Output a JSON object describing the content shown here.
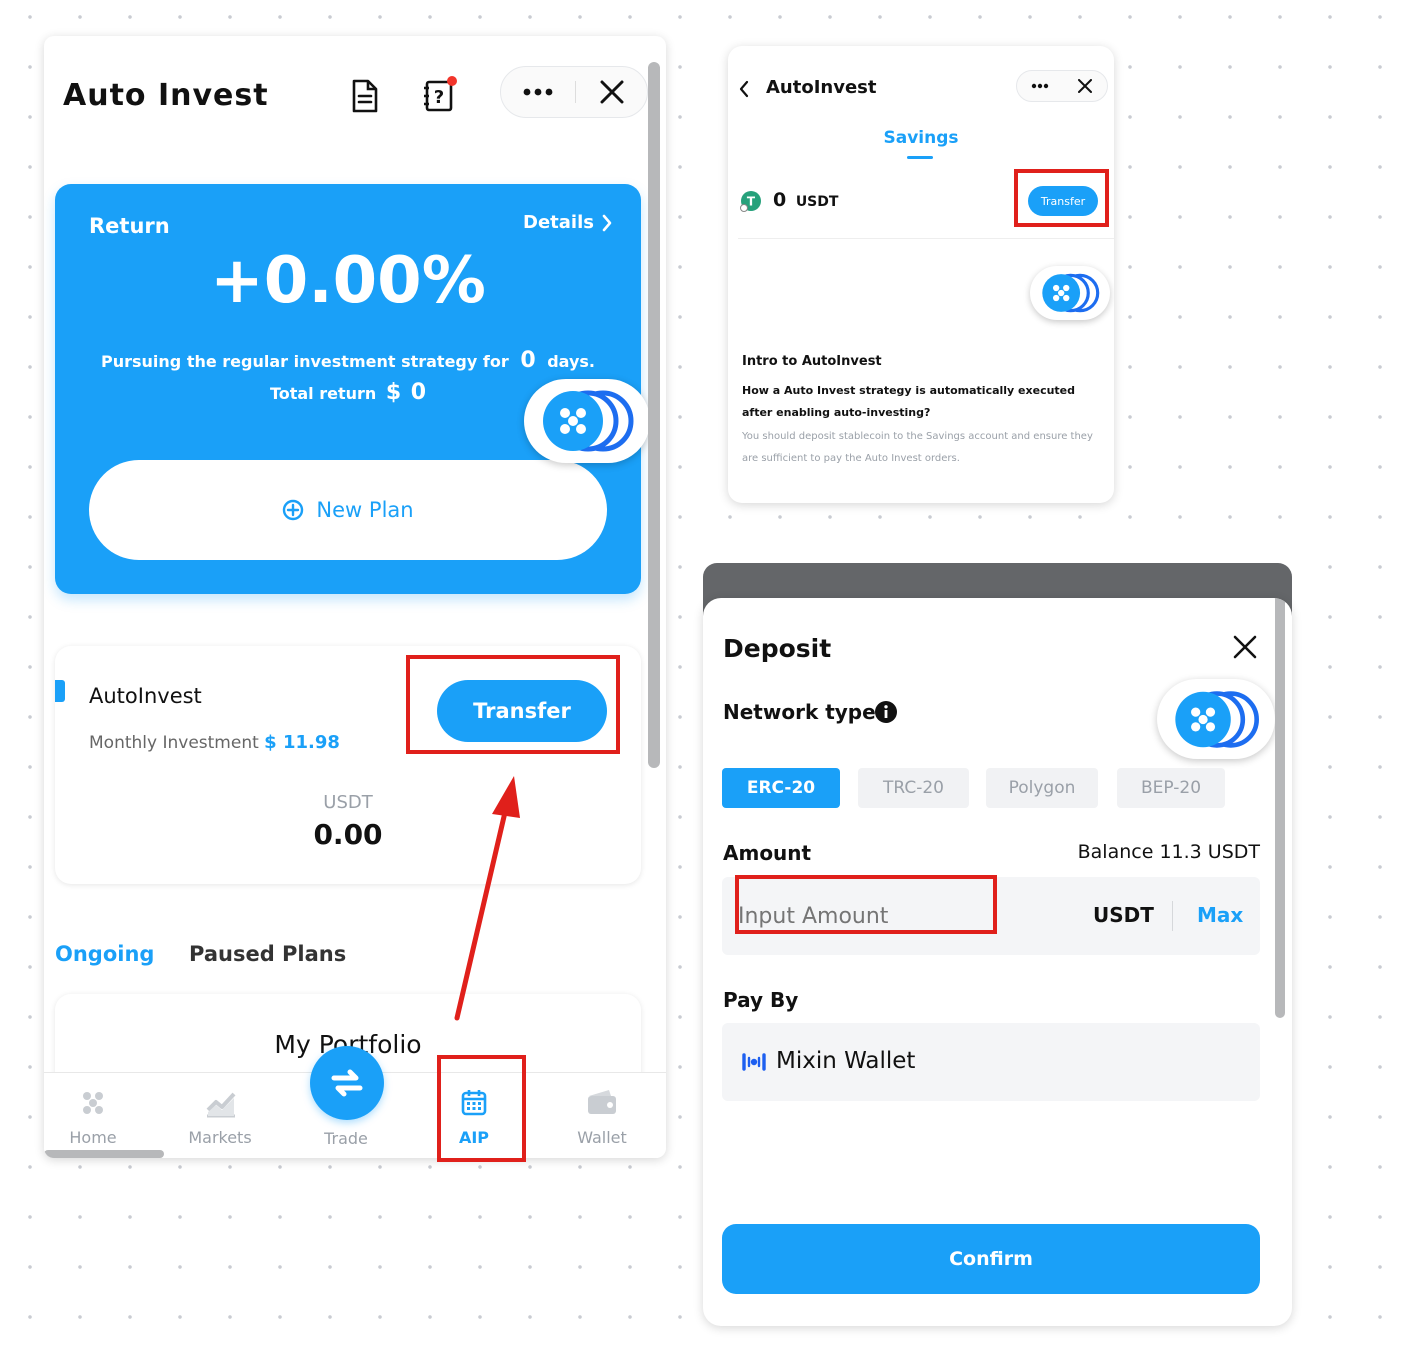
{
  "colors": {
    "accent": "#1aa0f8",
    "annotation": "#e0201b",
    "card_blue": "#1aa0f8"
  },
  "left": {
    "title": "Auto Invest",
    "icons": {
      "doc": "document-icon",
      "help": "help-icon",
      "more": "more-icon",
      "close": "close-icon"
    },
    "return_card": {
      "label": "Return",
      "details": "Details",
      "percent": "+0.00%",
      "strategy_prefix": "Pursuing the regular investment strategy for",
      "days_value": "0",
      "days_suffix": "days.",
      "total_label": "Total return",
      "total_currency": "$",
      "total_value": "0",
      "new_plan": "New Plan"
    },
    "autoinvest_card": {
      "name": "AutoInvest",
      "monthly_label": "Monthly Investment",
      "monthly_value": "$ 11.98",
      "transfer": "Transfer",
      "currency": "USDT",
      "amount": "0.00"
    },
    "tabs": [
      {
        "label": "Ongoing",
        "active": true
      },
      {
        "label": "Paused Plans",
        "active": false
      }
    ],
    "portfolio_title": "My Portfolio",
    "nav": [
      {
        "label": "Home",
        "icon": "home-icon"
      },
      {
        "label": "Markets",
        "icon": "markets-icon"
      },
      {
        "label": "Trade",
        "icon": "trade-icon"
      },
      {
        "label": "AIP",
        "icon": "calendar-icon",
        "active": true
      },
      {
        "label": "Wallet",
        "icon": "wallet-icon"
      }
    ]
  },
  "top_right": {
    "title": "AutoInvest",
    "tab": "Savings",
    "balance_value": "0",
    "balance_unit": "USDT",
    "transfer": "Transfer",
    "intro_title": "Intro to AutoInvest",
    "intro_question": "How a Auto Invest strategy is automatically executed after enabling auto-investing?",
    "intro_answer": "You should deposit stablecoin to the Savings account and ensure they are sufficient to pay the Auto Invest orders."
  },
  "deposit": {
    "title": "Deposit",
    "network_label": "Network type",
    "networks": [
      {
        "label": "ERC-20",
        "active": true
      },
      {
        "label": "TRC-20",
        "active": false
      },
      {
        "label": "Polygon",
        "active": false
      },
      {
        "label": "BEP-20",
        "active": false
      }
    ],
    "amount_label": "Amount",
    "balance": "Balance 11.3 USDT",
    "placeholder": "Input Amount",
    "unit": "USDT",
    "max": "Max",
    "pay_by_label": "Pay By",
    "wallet": "Mixin Wallet",
    "confirm": "Confirm"
  }
}
